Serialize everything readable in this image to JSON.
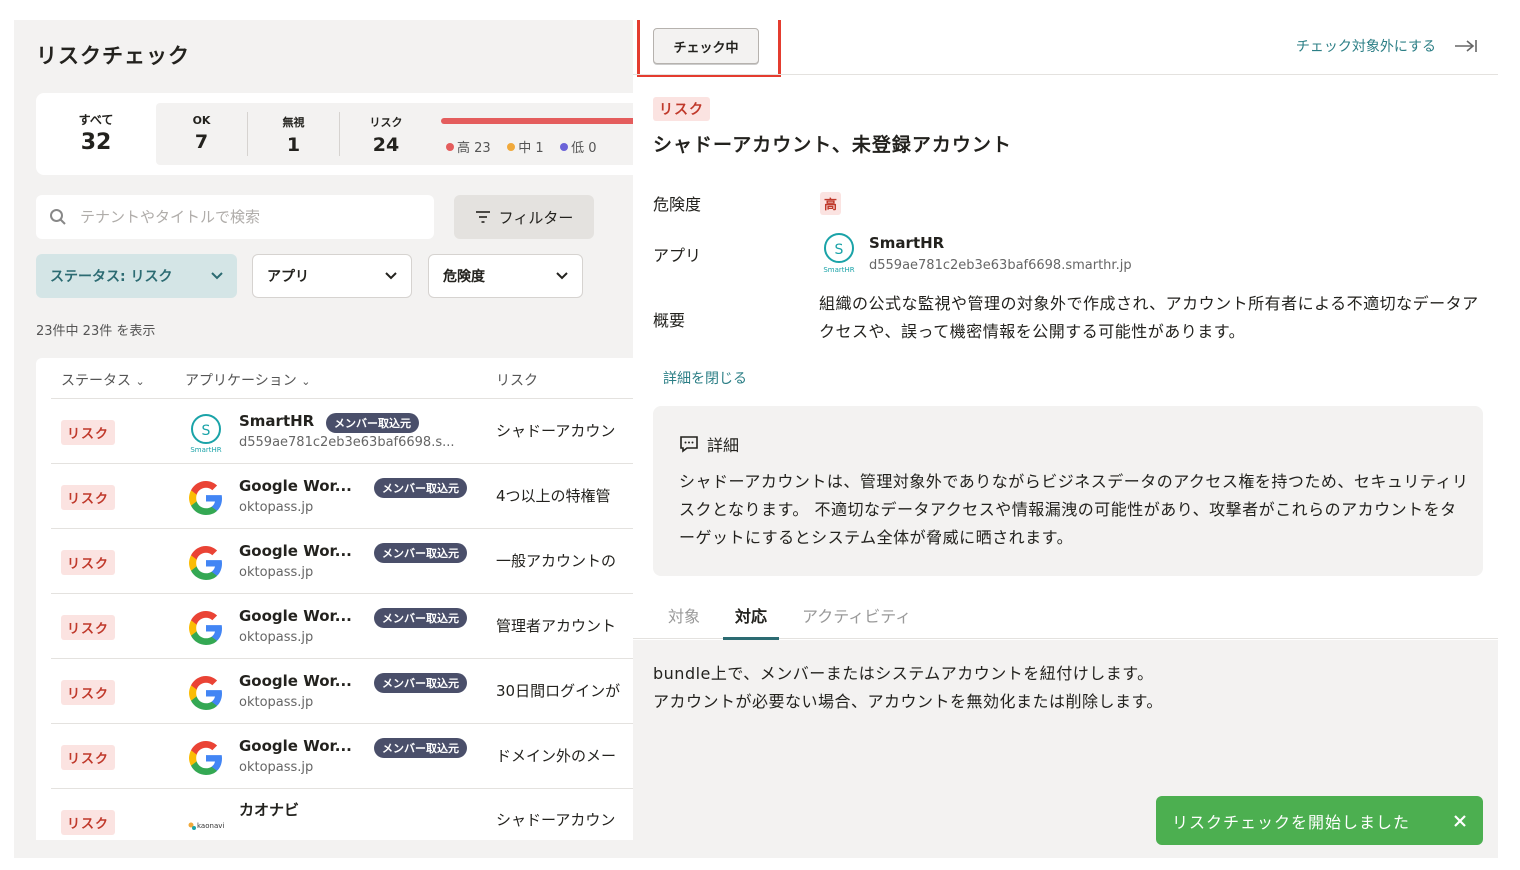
{
  "page": {
    "title": "リスクチェック"
  },
  "summary": {
    "all": {
      "label": "すべて",
      "value": "32"
    },
    "ok": {
      "label": "OK",
      "value": "7"
    },
    "ignored": {
      "label": "無視",
      "value": "1"
    },
    "risk": {
      "label": "リスク",
      "value": "24"
    },
    "legend": {
      "high": {
        "label": "高 23",
        "color": "#e45d5d"
      },
      "mid": {
        "label": "中 1",
        "color": "#f0a93b"
      },
      "low": {
        "label": "低 0",
        "color": "#6b63d8"
      }
    }
  },
  "search": {
    "placeholder": "テナントやタイトルで検索",
    "value": ""
  },
  "filter": {
    "label": "フィルター"
  },
  "dropdowns": {
    "status": {
      "label": "ステータス: リスク"
    },
    "app": {
      "label": "アプリ"
    },
    "severity": {
      "label": "危険度"
    }
  },
  "count_text": "23件中 23件 を表示",
  "table": {
    "headers": [
      "ステータス",
      "アプリケーション",
      "リスク"
    ],
    "rows": [
      {
        "status": "リスク",
        "app": "SmartHR",
        "sub": "d559ae781c2eb3e63baf6698.s...",
        "badge": "メンバー取込元",
        "risk": "シャドーアカウン",
        "icon": "smarthr-icon"
      },
      {
        "status": "リスク",
        "app": "Google Wor...",
        "sub": "oktopass.jp",
        "badge": "メンバー取込元",
        "risk": "4つ以上の特権管",
        "icon": "google-icon"
      },
      {
        "status": "リスク",
        "app": "Google Wor...",
        "sub": "oktopass.jp",
        "badge": "メンバー取込元",
        "risk": "一般アカウントの",
        "icon": "google-icon"
      },
      {
        "status": "リスク",
        "app": "Google Wor...",
        "sub": "oktopass.jp",
        "badge": "メンバー取込元",
        "risk": "管理者アカウント",
        "icon": "google-icon"
      },
      {
        "status": "リスク",
        "app": "Google Wor...",
        "sub": "oktopass.jp",
        "badge": "メンバー取込元",
        "risk": "30日間ログインが",
        "icon": "google-icon"
      },
      {
        "status": "リスク",
        "app": "Google Wor...",
        "sub": "oktopass.jp",
        "badge": "メンバー取込元",
        "risk": "ドメイン外のメー",
        "icon": "google-icon"
      },
      {
        "status": "リスク",
        "app": "カオナビ",
        "sub": "",
        "badge": "",
        "risk": "シャドーアカウン",
        "icon": "kaonavi-icon"
      }
    ]
  },
  "detail": {
    "checking_label": "チェック中",
    "exclude_label": "チェック対象外にする",
    "risk_tag": "リスク",
    "title": "シャドーアカウント、未登録アカウント",
    "severity_label": "危険度",
    "severity_value": "高",
    "app_label": "アプリ",
    "app_name": "SmartHR",
    "app_domain": "d559ae781c2eb3e63baf6698.smarthr.jp",
    "overview_label": "概要",
    "overview": "組織の公式な監視や管理の対象外で作成され、アカウント所有者による不適切なデータアクセスや、誤って機密情報を公開する可能性があります。",
    "close_label": "詳細を閉じる",
    "box_title": "詳細",
    "box_body": "シャドーアカウントは、管理対象外でありながらビジネスデータのアクセス権を持つため、セキュリティリスクとなります。 不適切なデータアクセスや情報漏洩の可能性があり、攻撃者がこれらのアカウントをターゲットにするとシステム全体が脅威に晒されます。",
    "tabs": [
      "対象",
      "対応",
      "アクティビティ"
    ],
    "response_lines": [
      "bundle上で、メンバーまたはシステムアカウントを紐付けします。",
      "アカウントが必要ない場合、アカウントを無効化または削除します。"
    ]
  },
  "toast": {
    "message": "リスクチェックを開始しました"
  },
  "icons": {
    "smarthr_label": "SmartHR",
    "kaonavi_label": "kaonavi"
  },
  "colors": {
    "accent": "#2c6b72",
    "risk": "#c0392b",
    "toast": "#4caf50",
    "highlight": "#e43c2f"
  }
}
